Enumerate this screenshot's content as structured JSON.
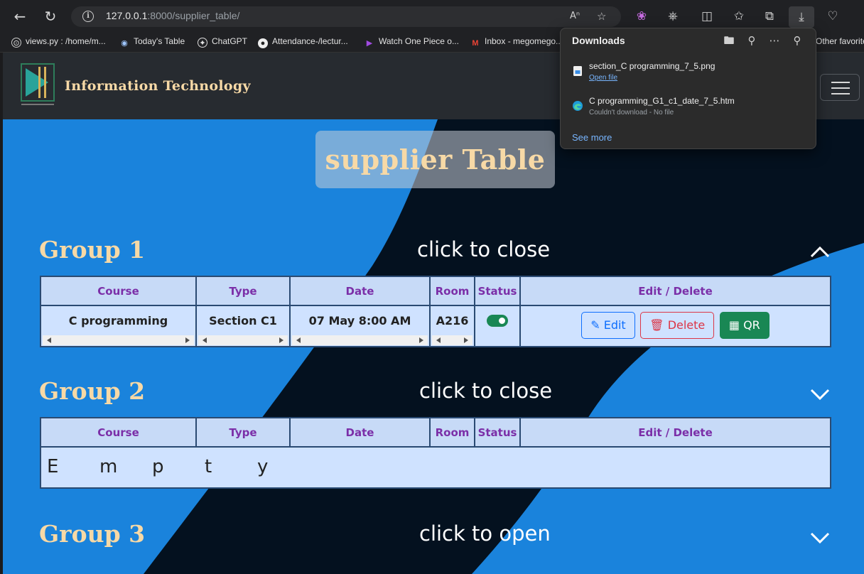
{
  "browser": {
    "url_host": "127.0.0.1",
    "url_path": ":8000/supplier_table/",
    "bookmarks": [
      {
        "label": "views.py : /home/m...",
        "icon": "github-icon"
      },
      {
        "label": "Today's Table",
        "icon": "eye-icon"
      },
      {
        "label": "ChatGPT",
        "icon": "chatgpt-icon"
      },
      {
        "label": "Attendance-/lectur...",
        "icon": "github-icon"
      },
      {
        "label": "Watch One Piece o...",
        "icon": "play-icon"
      },
      {
        "label": "Inbox - megomego...",
        "icon": "gmail-icon"
      },
      {
        "label": "Other favorite",
        "icon": "folder-icon"
      }
    ]
  },
  "downloads": {
    "title": "Downloads",
    "items": [
      {
        "name": "section_C programming_7_5.png",
        "status": "Open file",
        "icon": "image-file-icon"
      },
      {
        "name": "C programming_G1_c1_date_7_5.htm",
        "status": "Couldn't download - No file",
        "icon": "edge-icon"
      }
    ],
    "see_more": "See more"
  },
  "site": {
    "brand": "Information Technology",
    "page_title": "supplier Table"
  },
  "table_headers": [
    "Course",
    "Type",
    "Date",
    "Room",
    "Status",
    "Edit / Delete"
  ],
  "groups": [
    {
      "title": "Group 1",
      "toggle": "click to close",
      "chevron": "chevron-up-icon",
      "rows": [
        {
          "course": "C programming",
          "type": "Section C1",
          "date": "07 May 8:00 AM",
          "room": "A216",
          "status": "on"
        }
      ],
      "actions": {
        "edit": "Edit",
        "delete": "Delete",
        "qr": "QR"
      }
    },
    {
      "title": "Group 2",
      "toggle": "click to close",
      "chevron": "chevron-down-icon",
      "empty_text": [
        "E",
        "m",
        "p",
        "t",
        "y"
      ]
    },
    {
      "title": "Group 3",
      "toggle": "click to open",
      "chevron": "chevron-down-icon"
    }
  ],
  "colors": {
    "accent_gold": "#f7d9a6",
    "page_blue": "#1a83dc",
    "dark_diagonal": "#04111f",
    "header_purple": "#7b2fa8",
    "success": "#198754",
    "danger": "#dc3545",
    "primary": "#0d6efd"
  }
}
